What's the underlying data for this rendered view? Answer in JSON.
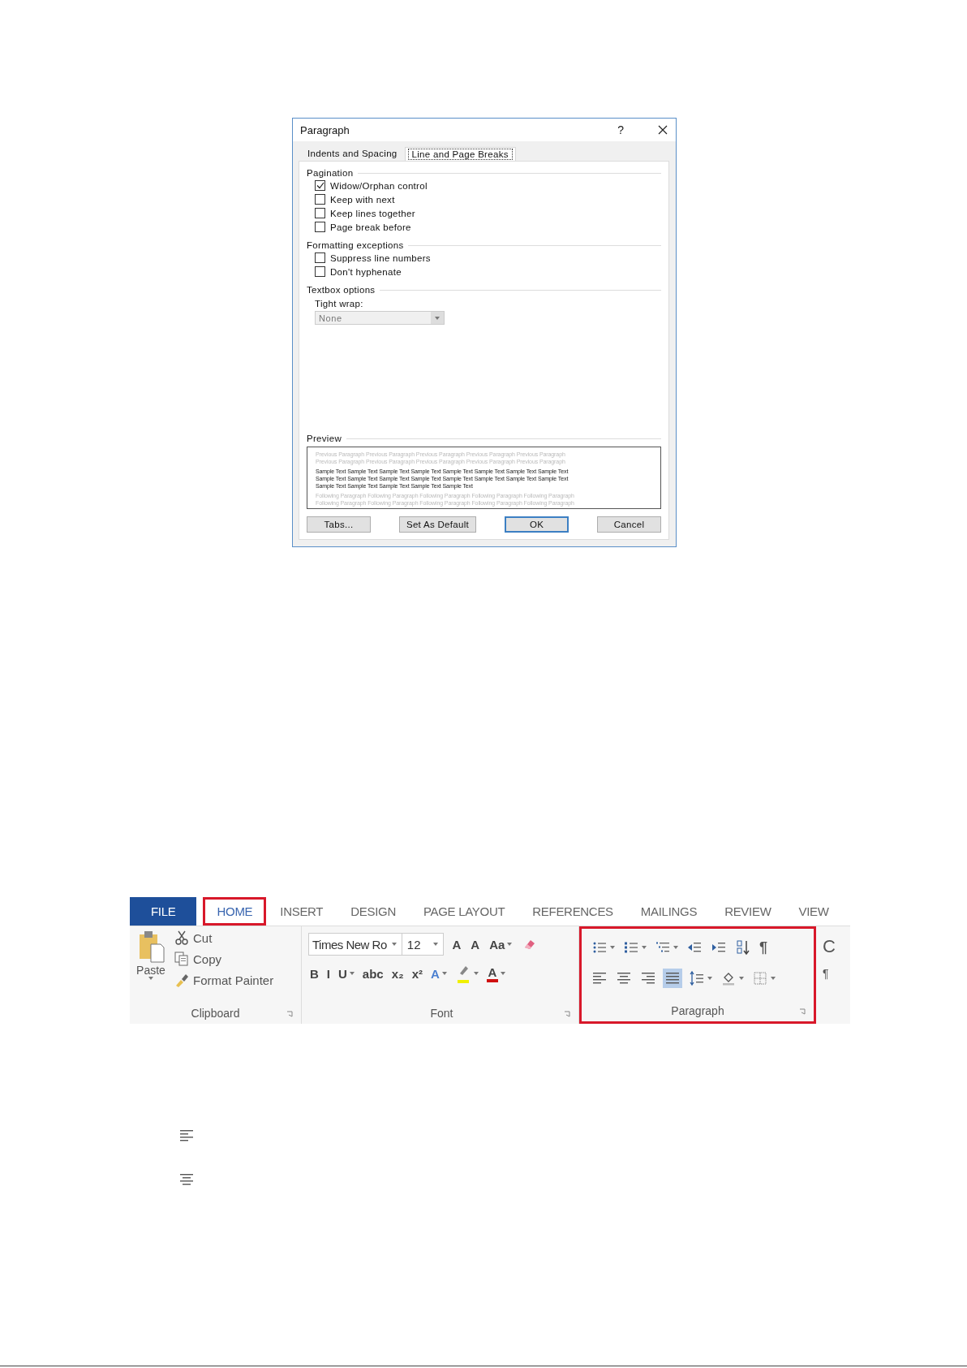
{
  "dialog": {
    "title": "Paragraph",
    "help": "?",
    "tabs": [
      {
        "label": "Indents and Spacing",
        "selected": false
      },
      {
        "label": "Line and Page Breaks",
        "selected": true
      }
    ],
    "sections": [
      {
        "title": "Pagination",
        "checkboxes": [
          {
            "label": "Widow/Orphan control",
            "checked": true
          },
          {
            "label": "Keep with next",
            "checked": false
          },
          {
            "label": "Keep lines together",
            "checked": false
          },
          {
            "label": "Page break before",
            "checked": false
          }
        ]
      },
      {
        "title": "Formatting exceptions",
        "checkboxes": [
          {
            "label": "Suppress line numbers",
            "checked": false
          },
          {
            "label": "Don't hyphenate",
            "checked": false
          }
        ]
      },
      {
        "title": "Textbox options",
        "field_label": "Tight wrap:",
        "dropdown": {
          "value": "None",
          "disabled": true
        }
      }
    ],
    "preview": {
      "title": "Preview",
      "previous": [
        "Previous Paragraph Previous Paragraph Previous Paragraph Previous Paragraph Previous Paragraph",
        "Previous Paragraph Previous Paragraph Previous Paragraph Previous Paragraph Previous Paragraph"
      ],
      "sample": [
        "Sample Text Sample Text Sample Text Sample Text Sample Text Sample Text Sample Text Sample Text",
        "Sample Text Sample Text Sample Text Sample Text Sample Text Sample Text Sample Text Sample Text",
        "Sample Text Sample Text Sample Text Sample Text Sample Text"
      ],
      "following": [
        "Following Paragraph Following Paragraph Following Paragraph Following Paragraph Following Paragraph",
        "Following Paragraph Following Paragraph Following Paragraph Following Paragraph Following Paragraph"
      ]
    },
    "buttons": [
      {
        "label": "Tabs...",
        "default": false
      },
      {
        "label": "Set As Default",
        "default": false
      },
      {
        "label": "OK",
        "default": true
      },
      {
        "label": "Cancel",
        "default": false
      }
    ]
  },
  "ribbon": {
    "tabs": [
      {
        "label": "FILE",
        "kind": "file",
        "selected": false,
        "highlighted": false
      },
      {
        "label": "HOME",
        "kind": "tab",
        "selected": true,
        "highlighted": true
      },
      {
        "label": "INSERT",
        "kind": "tab",
        "selected": false,
        "highlighted": false
      },
      {
        "label": "DESIGN",
        "kind": "tab",
        "selected": false,
        "highlighted": false
      },
      {
        "label": "PAGE LAYOUT",
        "kind": "tab",
        "selected": false,
        "highlighted": false
      },
      {
        "label": "REFERENCES",
        "kind": "tab",
        "selected": false,
        "highlighted": false
      },
      {
        "label": "MAILINGS",
        "kind": "tab",
        "selected": false,
        "highlighted": false
      },
      {
        "label": "REVIEW",
        "kind": "tab",
        "selected": false,
        "highlighted": false
      },
      {
        "label": "VIEW",
        "kind": "tab",
        "selected": false,
        "highlighted": false
      }
    ],
    "clipboard": {
      "label": "Clipboard",
      "paste": "Paste",
      "items": [
        {
          "kind": "cut",
          "label": "Cut"
        },
        {
          "kind": "copy",
          "label": "Copy"
        },
        {
          "kind": "painter",
          "label": "Format Painter"
        }
      ]
    },
    "font": {
      "label": "Font",
      "font_name": "Times New Ro",
      "font_size": "12",
      "row1": [
        {
          "kind": "text",
          "text": "A"
        },
        {
          "kind": "text",
          "text": "A"
        },
        {
          "kind": "dropdown",
          "text": "Aa"
        },
        {
          "kind": "eraser"
        }
      ],
      "row2": [
        {
          "kind": "text",
          "text": "B"
        },
        {
          "kind": "text",
          "text": "I"
        },
        {
          "kind": "dropdown",
          "text": "U"
        },
        {
          "kind": "text",
          "text": "abc"
        },
        {
          "kind": "text",
          "text": "x₂"
        },
        {
          "kind": "text",
          "text": "x²"
        },
        {
          "kind": "dropdown",
          "text": "A",
          "color": "#4a7fd0"
        },
        {
          "kind": "highlighter",
          "color": "#f0f000"
        },
        {
          "kind": "dropdown",
          "text": "A",
          "color": "#d01010"
        }
      ]
    },
    "paragraph": {
      "label": "Paragraph",
      "highlighted": true,
      "row1": [
        {
          "kind": "bullets"
        },
        {
          "kind": "numbering"
        },
        {
          "kind": "multilevel"
        },
        {
          "kind": "outdent"
        },
        {
          "kind": "indent"
        },
        {
          "kind": "sort"
        },
        {
          "kind": "text",
          "text": "¶"
        }
      ],
      "row2": [
        {
          "kind": "align-left",
          "selected": false
        },
        {
          "kind": "align-center",
          "selected": false
        },
        {
          "kind": "align-right",
          "selected": false
        },
        {
          "kind": "justify",
          "selected": true
        },
        {
          "kind": "spacing",
          "selected": false
        },
        {
          "kind": "shading",
          "selected": false
        },
        {
          "kind": "borders",
          "selected": false
        }
      ]
    },
    "next_group": [
      "C",
      "¶"
    ]
  },
  "loose_icons": [
    {
      "kind": "align-left"
    },
    {
      "kind": "align-center"
    }
  ]
}
